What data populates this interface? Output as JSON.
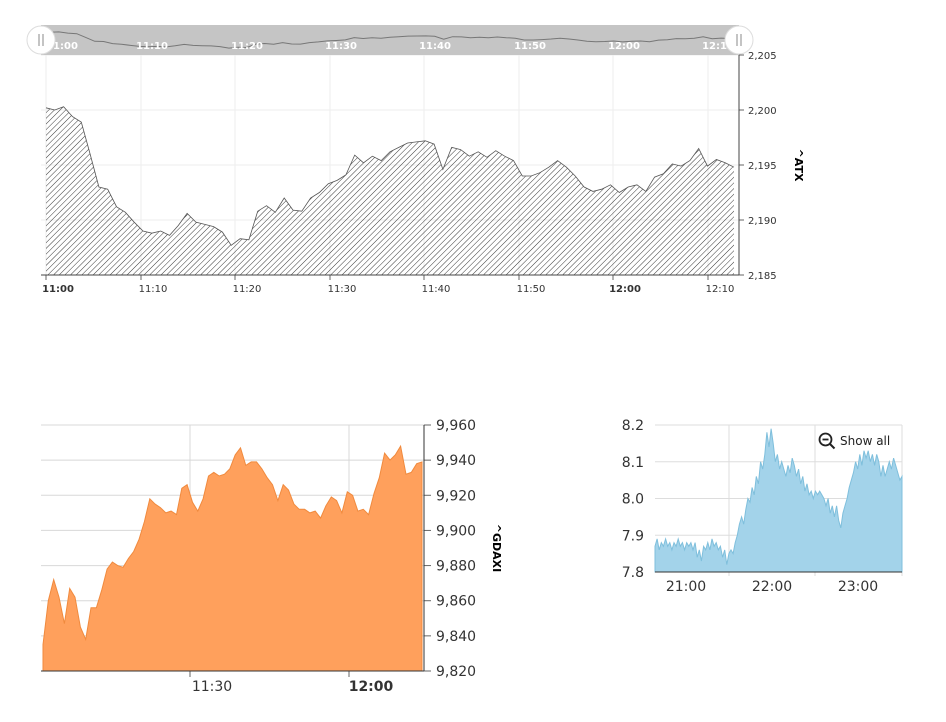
{
  "chart_data": [
    {
      "type": "area",
      "series": [
        {
          "name": "",
          "values": [
            2200.2,
            2200,
            2200.3,
            2199.4,
            2198.9,
            2196,
            2193,
            2192.8,
            2191.2,
            2190.7,
            2189.8,
            2189,
            2188.8,
            2189,
            2188.6,
            2189.5,
            2190.6,
            2189.8,
            2189.6,
            2189.4,
            2188.9,
            2187.7,
            2188.3,
            2188.2,
            2190.8,
            2191.3,
            2190.7,
            2192,
            2190.9,
            2190.8,
            2192,
            2192.5,
            2193.3,
            2193.6,
            2194.1,
            2195.9,
            2195.2,
            2195.8,
            2195.4,
            2196.2,
            2196.6,
            2197,
            2197.1,
            2197.2,
            2196.9,
            2194.6,
            2196.6,
            2196.4,
            2195.8,
            2196.2,
            2195.7,
            2196.3,
            2195.8,
            2195.4,
            2194,
            2194,
            2194.3,
            2194.8,
            2195.4,
            2194.8,
            2194,
            2193,
            2192.6,
            2192.8,
            2193.2,
            2192.5,
            2193,
            2193.2,
            2192.6,
            2193.9,
            2194.2,
            2195.1,
            2194.9,
            2195.4,
            2196.5,
            2194.9,
            2195.5,
            2195.2,
            2194.8
          ]
        }
      ],
      "x_ticks": [
        "11:00",
        "11:10",
        "11:20",
        "11:30",
        "11:40",
        "11:50",
        "12:00",
        "12:10"
      ],
      "x_ticks_bold": [
        "11:00",
        "12:00"
      ],
      "navigator_ticks": [
        "11:00",
        "11:10",
        "11:20",
        "11:30",
        "11:40",
        "11:50",
        "12:00",
        "12:10"
      ],
      "y_ticks": [
        "2,185",
        "2,190",
        "2,195",
        "2,200",
        "2,205"
      ],
      "ylim": [
        2185,
        2205
      ],
      "ylabel": "^ATX",
      "fill": "diagonal-hatch",
      "grid": true
    },
    {
      "type": "area",
      "series": [
        {
          "name": "",
          "values": [
            9835,
            9860,
            9872,
            9862,
            9847,
            9867,
            9862,
            9845,
            9838,
            9856,
            9856,
            9866,
            9878,
            9882,
            9880,
            9879,
            9884,
            9888,
            9895,
            9905,
            9918,
            9915,
            9913,
            9910,
            9911,
            9909,
            9924,
            9926,
            9916,
            9911,
            9918,
            9931,
            9933,
            9931,
            9932,
            9935,
            9943,
            9947,
            9937,
            9939,
            9939,
            9935,
            9930,
            9926,
            9917,
            9926,
            9923,
            9915,
            9912,
            9912,
            9910,
            9911,
            9907,
            9914,
            9919,
            9917,
            9910,
            9922,
            9920,
            9911,
            9912,
            9909,
            9921,
            9930,
            9944,
            9940,
            9943,
            9948,
            9932,
            9933,
            9938,
            9939
          ]
        }
      ],
      "x_ticks": [
        "11:30",
        "12:00"
      ],
      "x_ticks_bold": [
        "12:00"
      ],
      "y_ticks": [
        "9,820",
        "9,840",
        "9,860",
        "9,880",
        "9,900",
        "9,920",
        "9,940",
        "9,960"
      ],
      "ylim": [
        9820,
        9960
      ],
      "ylabel": "^GDAXI",
      "color": "#ffa05c",
      "grid": true
    },
    {
      "type": "area",
      "series": [
        {
          "name": "",
          "values": [
            7.87,
            7.89,
            7.86,
            7.88,
            7.87,
            7.89,
            7.87,
            7.88,
            7.86,
            7.88,
            7.87,
            7.89,
            7.87,
            7.88,
            7.86,
            7.88,
            7.87,
            7.88,
            7.86,
            7.88,
            7.84,
            7.86,
            7.83,
            7.87,
            7.86,
            7.88,
            7.86,
            7.89,
            7.87,
            7.88,
            7.86,
            7.87,
            7.84,
            7.86,
            7.82,
            7.85,
            7.86,
            7.85,
            7.88,
            7.9,
            7.93,
            7.95,
            7.93,
            7.97,
            8.0,
            7.99,
            8.03,
            8.01,
            8.06,
            8.04,
            8.1,
            8.08,
            8.12,
            8.18,
            8.14,
            8.19,
            8.15,
            8.1,
            8.12,
            8.08,
            8.1,
            8.08,
            8.06,
            8.09,
            8.07,
            8.11,
            8.09,
            8.06,
            8.08,
            8.04,
            8.06,
            8.02,
            8.04,
            8.01,
            8.02,
            8.0,
            8.02,
            8.01,
            8.02,
            8.01,
            8.0,
            7.98,
            8.0,
            7.96,
            7.98,
            7.95,
            7.98,
            7.94,
            7.92,
            7.96,
            7.98,
            8.0,
            8.03,
            8.05,
            8.07,
            8.1,
            8.08,
            8.12,
            8.09,
            8.13,
            8.11,
            8.13,
            8.1,
            8.12,
            8.09,
            8.12,
            8.1,
            8.06,
            8.09,
            8.06,
            8.08,
            8.1,
            8.08,
            8.11,
            8.09,
            8.07,
            8.05,
            8.06
          ]
        }
      ],
      "x_ticks": [
        "21:00",
        "22:00",
        "23:00"
      ],
      "y_ticks": [
        "7.8",
        "7.9",
        "8.0",
        "8.1",
        "8.2"
      ],
      "ylim": [
        7.8,
        8.2
      ],
      "color": "#a3d3ea",
      "line_color": "#7fbfdc",
      "grid": true
    }
  ],
  "show_all_label": "Show all"
}
